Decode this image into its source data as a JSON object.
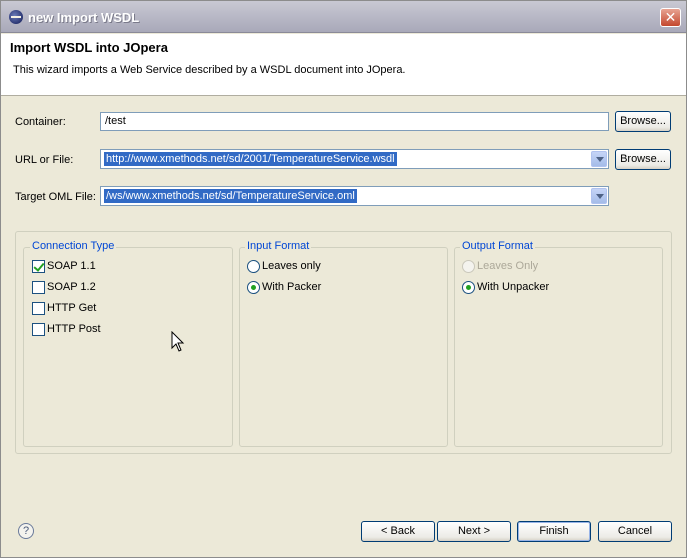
{
  "window": {
    "title": "new Import WSDL",
    "close_label": "✕"
  },
  "header": {
    "title": "Import WSDL into JOpera",
    "description": "This wizard imports a Web Service described by a WSDL document into JOpera."
  },
  "form": {
    "container_label": "Container:",
    "container_value": "/test",
    "url_label": "URL or File:",
    "url_value": "http://www.xmethods.net/sd/2001/TemperatureService.wsdl",
    "target_label": "Target OML File:",
    "target_value": "/ws/www.xmethods.net/sd/TemperatureService.oml",
    "browse_label": "Browse..."
  },
  "connection_type": {
    "title": "Connection Type",
    "options": [
      {
        "label": "SOAP 1.1",
        "checked": true
      },
      {
        "label": "SOAP 1.2",
        "checked": false
      },
      {
        "label": "HTTP Get",
        "checked": false
      },
      {
        "label": "HTTP Post",
        "checked": false
      }
    ]
  },
  "input_format": {
    "title": "Input Format",
    "options": [
      {
        "label": "Leaves only",
        "checked": false
      },
      {
        "label": "With Packer",
        "checked": true
      }
    ]
  },
  "output_format": {
    "title": "Output Format",
    "options": [
      {
        "label": "Leaves Only",
        "checked": false,
        "disabled": true
      },
      {
        "label": "With Unpacker",
        "checked": true
      }
    ]
  },
  "buttons": {
    "back": "< Back",
    "next": "Next >",
    "finish": "Finish",
    "cancel": "Cancel"
  },
  "help_label": "?",
  "icons": {
    "title_icon": "eclipse-icon",
    "help": "help-icon",
    "cursor": "mouse-pointer-icon"
  }
}
